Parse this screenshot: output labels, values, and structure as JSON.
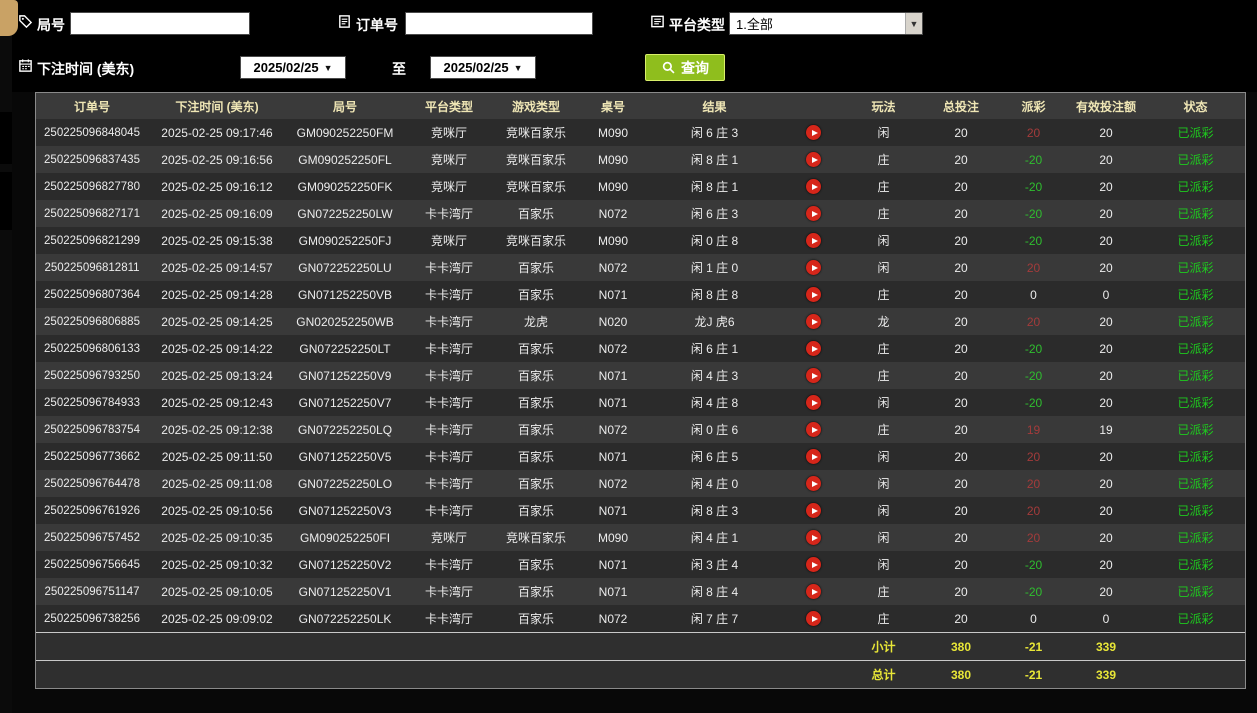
{
  "filters": {
    "round": {
      "label": "局号",
      "value": ""
    },
    "order": {
      "label": "订单号",
      "value": ""
    },
    "platform": {
      "label": "平台类型",
      "value": "1.全部"
    },
    "bet_time": {
      "label": "下注时间 (美东)",
      "from": "2025/02/25",
      "to_label": "至",
      "to": "2025/02/25"
    },
    "query_label": "查询"
  },
  "table": {
    "headers": [
      "订单号",
      "下注时间 (美东)",
      "局号",
      "平台类型",
      "游戏类型",
      "桌号",
      "结果",
      "",
      "玩法",
      "总投注",
      "派彩",
      "有效投注额",
      "状态"
    ],
    "rows": [
      {
        "order": "250225096848045",
        "time": "2025-02-25 09:17:46",
        "round": "GM090252250FM",
        "platform": "竞咪厅",
        "game": "竞咪百家乐",
        "table_no": "M090",
        "result": "闲 6 庄 3",
        "bet": "闲",
        "total_bet": "20",
        "payout": "20",
        "payout_sign": "pos",
        "valid_bet": "20",
        "status": "已派彩"
      },
      {
        "order": "250225096837435",
        "time": "2025-02-25 09:16:56",
        "round": "GM090252250FL",
        "platform": "竞咪厅",
        "game": "竞咪百家乐",
        "table_no": "M090",
        "result": "闲 8 庄 1",
        "bet": "庄",
        "total_bet": "20",
        "payout": "-20",
        "payout_sign": "neg",
        "valid_bet": "20",
        "status": "已派彩"
      },
      {
        "order": "250225096827780",
        "time": "2025-02-25 09:16:12",
        "round": "GM090252250FK",
        "platform": "竞咪厅",
        "game": "竞咪百家乐",
        "table_no": "M090",
        "result": "闲 8 庄 1",
        "bet": "庄",
        "total_bet": "20",
        "payout": "-20",
        "payout_sign": "neg",
        "valid_bet": "20",
        "status": "已派彩"
      },
      {
        "order": "250225096827171",
        "time": "2025-02-25 09:16:09",
        "round": "GN072252250LW",
        "platform": "卡卡湾厅",
        "game": "百家乐",
        "table_no": "N072",
        "result": "闲 6 庄 3",
        "bet": "庄",
        "total_bet": "20",
        "payout": "-20",
        "payout_sign": "neg",
        "valid_bet": "20",
        "status": "已派彩"
      },
      {
        "order": "250225096821299",
        "time": "2025-02-25 09:15:38",
        "round": "GM090252250FJ",
        "platform": "竞咪厅",
        "game": "竞咪百家乐",
        "table_no": "M090",
        "result": "闲 0 庄 8",
        "bet": "闲",
        "total_bet": "20",
        "payout": "-20",
        "payout_sign": "neg",
        "valid_bet": "20",
        "status": "已派彩"
      },
      {
        "order": "250225096812811",
        "time": "2025-02-25 09:14:57",
        "round": "GN072252250LU",
        "platform": "卡卡湾厅",
        "game": "百家乐",
        "table_no": "N072",
        "result": "闲 1 庄 0",
        "bet": "闲",
        "total_bet": "20",
        "payout": "20",
        "payout_sign": "pos",
        "valid_bet": "20",
        "status": "已派彩"
      },
      {
        "order": "250225096807364",
        "time": "2025-02-25 09:14:28",
        "round": "GN071252250VB",
        "platform": "卡卡湾厅",
        "game": "百家乐",
        "table_no": "N071",
        "result": "闲 8 庄 8",
        "bet": "庄",
        "total_bet": "20",
        "payout": "0",
        "payout_sign": "zero",
        "valid_bet": "0",
        "status": "已派彩"
      },
      {
        "order": "250225096806885",
        "time": "2025-02-25 09:14:25",
        "round": "GN020252250WB",
        "platform": "卡卡湾厅",
        "game": "龙虎",
        "table_no": "N020",
        "result": "龙J 虎6",
        "bet": "龙",
        "total_bet": "20",
        "payout": "20",
        "payout_sign": "pos",
        "valid_bet": "20",
        "status": "已派彩"
      },
      {
        "order": "250225096806133",
        "time": "2025-02-25 09:14:22",
        "round": "GN072252250LT",
        "platform": "卡卡湾厅",
        "game": "百家乐",
        "table_no": "N072",
        "result": "闲 6 庄 1",
        "bet": "庄",
        "total_bet": "20",
        "payout": "-20",
        "payout_sign": "neg",
        "valid_bet": "20",
        "status": "已派彩"
      },
      {
        "order": "250225096793250",
        "time": "2025-02-25 09:13:24",
        "round": "GN071252250V9",
        "platform": "卡卡湾厅",
        "game": "百家乐",
        "table_no": "N071",
        "result": "闲 4 庄 3",
        "bet": "庄",
        "total_bet": "20",
        "payout": "-20",
        "payout_sign": "neg",
        "valid_bet": "20",
        "status": "已派彩"
      },
      {
        "order": "250225096784933",
        "time": "2025-02-25 09:12:43",
        "round": "GN071252250V7",
        "platform": "卡卡湾厅",
        "game": "百家乐",
        "table_no": "N071",
        "result": "闲 4 庄 8",
        "bet": "闲",
        "total_bet": "20",
        "payout": "-20",
        "payout_sign": "neg",
        "valid_bet": "20",
        "status": "已派彩"
      },
      {
        "order": "250225096783754",
        "time": "2025-02-25 09:12:38",
        "round": "GN072252250LQ",
        "platform": "卡卡湾厅",
        "game": "百家乐",
        "table_no": "N072",
        "result": "闲 0 庄 6",
        "bet": "庄",
        "total_bet": "20",
        "payout": "19",
        "payout_sign": "pos",
        "valid_bet": "19",
        "status": "已派彩"
      },
      {
        "order": "250225096773662",
        "time": "2025-02-25 09:11:50",
        "round": "GN071252250V5",
        "platform": "卡卡湾厅",
        "game": "百家乐",
        "table_no": "N071",
        "result": "闲 6 庄 5",
        "bet": "闲",
        "total_bet": "20",
        "payout": "20",
        "payout_sign": "pos",
        "valid_bet": "20",
        "status": "已派彩"
      },
      {
        "order": "250225096764478",
        "time": "2025-02-25 09:11:08",
        "round": "GN072252250LO",
        "platform": "卡卡湾厅",
        "game": "百家乐",
        "table_no": "N072",
        "result": "闲 4 庄 0",
        "bet": "闲",
        "total_bet": "20",
        "payout": "20",
        "payout_sign": "pos",
        "valid_bet": "20",
        "status": "已派彩"
      },
      {
        "order": "250225096761926",
        "time": "2025-02-25 09:10:56",
        "round": "GN071252250V3",
        "platform": "卡卡湾厅",
        "game": "百家乐",
        "table_no": "N071",
        "result": "闲 8 庄 3",
        "bet": "闲",
        "total_bet": "20",
        "payout": "20",
        "payout_sign": "pos",
        "valid_bet": "20",
        "status": "已派彩"
      },
      {
        "order": "250225096757452",
        "time": "2025-02-25 09:10:35",
        "round": "GM090252250FI",
        "platform": "竞咪厅",
        "game": "竞咪百家乐",
        "table_no": "M090",
        "result": "闲 4 庄 1",
        "bet": "闲",
        "total_bet": "20",
        "payout": "20",
        "payout_sign": "pos",
        "valid_bet": "20",
        "status": "已派彩"
      },
      {
        "order": "250225096756645",
        "time": "2025-02-25 09:10:32",
        "round": "GN071252250V2",
        "platform": "卡卡湾厅",
        "game": "百家乐",
        "table_no": "N071",
        "result": "闲 3 庄 4",
        "bet": "闲",
        "total_bet": "20",
        "payout": "-20",
        "payout_sign": "neg",
        "valid_bet": "20",
        "status": "已派彩"
      },
      {
        "order": "250225096751147",
        "time": "2025-02-25 09:10:05",
        "round": "GN071252250V1",
        "platform": "卡卡湾厅",
        "game": "百家乐",
        "table_no": "N071",
        "result": "闲 8 庄 4",
        "bet": "庄",
        "total_bet": "20",
        "payout": "-20",
        "payout_sign": "neg",
        "valid_bet": "20",
        "status": "已派彩"
      },
      {
        "order": "250225096738256",
        "time": "2025-02-25 09:09:02",
        "round": "GN072252250LK",
        "platform": "卡卡湾厅",
        "game": "百家乐",
        "table_no": "N072",
        "result": "闲 7 庄 7",
        "bet": "庄",
        "total_bet": "20",
        "payout": "0",
        "payout_sign": "zero",
        "valid_bet": "0",
        "status": "已派彩"
      }
    ],
    "summary": [
      {
        "label": "小计",
        "total_bet": "380",
        "payout": "-21",
        "valid_bet": "339"
      },
      {
        "label": "总计",
        "total_bet": "380",
        "payout": "-21",
        "valid_bet": "339"
      }
    ]
  },
  "colors": {
    "accent_green": "#8fbe1d",
    "accent_green_border": "#d9ef6a",
    "status_green": "#1ecb1e",
    "payout_pos": "#a33b3b",
    "payout_neg": "#2fbd2f",
    "summary_yellow": "#e8e637",
    "play_red": "#d6261a",
    "rail_tan": "#c9a265"
  }
}
